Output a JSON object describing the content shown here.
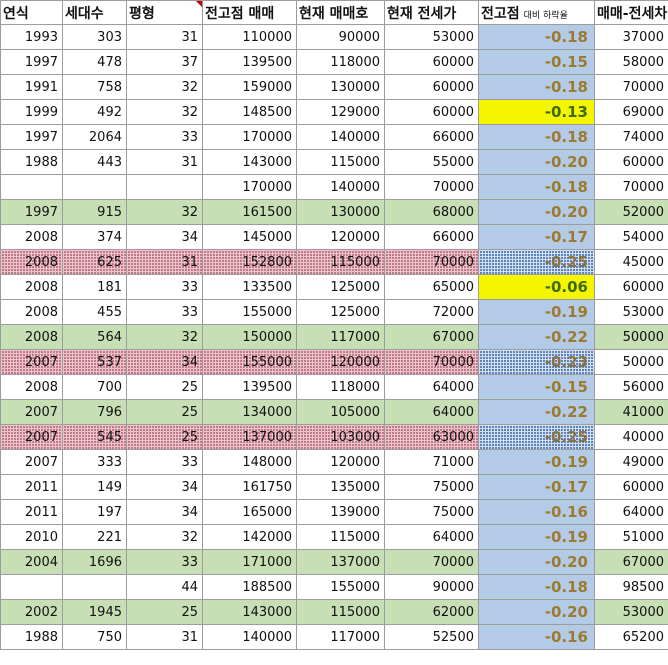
{
  "headers": {
    "year": "연식",
    "households": "세대수",
    "pyeong": "평형",
    "peak_price": "전고점 매매",
    "current_price": "현재 매매호",
    "current_jeonse": "현재 전세가",
    "drop_rate": "전고점",
    "drop_rate_sub": "대비 하락율",
    "gap": "매매-전세차"
  },
  "rows": [
    {
      "year": "1993",
      "households": "303",
      "pyeong": "31",
      "peak": "110000",
      "current": "90000",
      "jeonse": "53000",
      "rate": "-0.18",
      "gap": "37000"
    },
    {
      "year": "1997",
      "households": "478",
      "pyeong": "37",
      "peak": "139500",
      "current": "118000",
      "jeonse": "60000",
      "rate": "-0.15",
      "gap": "58000"
    },
    {
      "year": "1991",
      "households": "758",
      "pyeong": "32",
      "peak": "159000",
      "current": "130000",
      "jeonse": "60000",
      "rate": "-0.18",
      "gap": "70000"
    },
    {
      "year": "1999",
      "households": "492",
      "pyeong": "32",
      "peak": "148500",
      "current": "129000",
      "jeonse": "60000",
      "rate": "-0.13",
      "gap": "69000"
    },
    {
      "year": "1997",
      "households": "2064",
      "pyeong": "33",
      "peak": "170000",
      "current": "140000",
      "jeonse": "66000",
      "rate": "-0.18",
      "gap": "74000"
    },
    {
      "year": "1988",
      "households": "443",
      "pyeong": "31",
      "peak": "143000",
      "current": "115000",
      "jeonse": "55000",
      "rate": "-0.20",
      "gap": "60000"
    },
    {
      "year": "",
      "households": "",
      "pyeong": "",
      "peak": "170000",
      "current": "140000",
      "jeonse": "70000",
      "rate": "-0.18",
      "gap": "70000"
    },
    {
      "year": "1997",
      "households": "915",
      "pyeong": "32",
      "peak": "161500",
      "current": "130000",
      "jeonse": "68000",
      "rate": "-0.20",
      "gap": "52000"
    },
    {
      "year": "2008",
      "households": "374",
      "pyeong": "34",
      "peak": "145000",
      "current": "120000",
      "jeonse": "66000",
      "rate": "-0.17",
      "gap": "54000"
    },
    {
      "year": "2008",
      "households": "625",
      "pyeong": "31",
      "peak": "152800",
      "current": "115000",
      "jeonse": "70000",
      "rate": "-0.25",
      "gap": "45000"
    },
    {
      "year": "2008",
      "households": "181",
      "pyeong": "33",
      "peak": "133500",
      "current": "125000",
      "jeonse": "65000",
      "rate": "-0.06",
      "gap": "60000"
    },
    {
      "year": "2008",
      "households": "455",
      "pyeong": "33",
      "peak": "155000",
      "current": "125000",
      "jeonse": "72000",
      "rate": "-0.19",
      "gap": "53000"
    },
    {
      "year": "2008",
      "households": "564",
      "pyeong": "32",
      "peak": "150000",
      "current": "117000",
      "jeonse": "67000",
      "rate": "-0.22",
      "gap": "50000"
    },
    {
      "year": "2007",
      "households": "537",
      "pyeong": "34",
      "peak": "155000",
      "current": "120000",
      "jeonse": "70000",
      "rate": "-0.23",
      "gap": "50000"
    },
    {
      "year": "2008",
      "households": "700",
      "pyeong": "25",
      "peak": "139500",
      "current": "118000",
      "jeonse": "64000",
      "rate": "-0.15",
      "gap": "56000"
    },
    {
      "year": "2007",
      "households": "796",
      "pyeong": "25",
      "peak": "134000",
      "current": "105000",
      "jeonse": "64000",
      "rate": "-0.22",
      "gap": "41000"
    },
    {
      "year": "2007",
      "households": "545",
      "pyeong": "25",
      "peak": "137000",
      "current": "103000",
      "jeonse": "63000",
      "rate": "-0.25",
      "gap": "40000"
    },
    {
      "year": "2007",
      "households": "333",
      "pyeong": "33",
      "peak": "148000",
      "current": "120000",
      "jeonse": "71000",
      "rate": "-0.19",
      "gap": "49000"
    },
    {
      "year": "2011",
      "households": "149",
      "pyeong": "34",
      "peak": "161750",
      "current": "135000",
      "jeonse": "75000",
      "rate": "-0.17",
      "gap": "60000"
    },
    {
      "year": "2011",
      "households": "197",
      "pyeong": "34",
      "peak": "165000",
      "current": "139000",
      "jeonse": "75000",
      "rate": "-0.16",
      "gap": "64000"
    },
    {
      "year": "2010",
      "households": "221",
      "pyeong": "32",
      "peak": "142000",
      "current": "115000",
      "jeonse": "64000",
      "rate": "-0.19",
      "gap": "51000"
    },
    {
      "year": "2004",
      "households": "1696",
      "pyeong": "33",
      "peak": "171000",
      "current": "137000",
      "jeonse": "70000",
      "rate": "-0.20",
      "gap": "67000"
    },
    {
      "year": "",
      "households": "",
      "pyeong": "44",
      "peak": "188500",
      "current": "155000",
      "jeonse": "90000",
      "rate": "-0.18",
      "gap": "98500"
    },
    {
      "year": "2002",
      "households": "1945",
      "pyeong": "25",
      "peak": "143000",
      "current": "115000",
      "jeonse": "62000",
      "rate": "-0.20",
      "gap": "53000"
    },
    {
      "year": "1988",
      "households": "750",
      "pyeong": "31",
      "peak": "140000",
      "current": "117000",
      "jeonse": "52500",
      "rate": "-0.16",
      "gap": "65200"
    }
  ],
  "row_styles": [
    "",
    "",
    "",
    "hl",
    "",
    "",
    "",
    "green",
    "",
    "pink",
    "hl",
    "",
    "green",
    "pink",
    "",
    "green",
    "pink",
    "",
    "",
    "",
    "",
    "green",
    "",
    "green",
    ""
  ],
  "colors": {
    "green_fill": "#c6dfb5",
    "pink_fill": "#f2c2cb",
    "rate_fill": "#b4cbe8",
    "highlight_fill": "#f5f500",
    "rate_text": "#9c7b2e",
    "comment_marker": "#c00000"
  }
}
